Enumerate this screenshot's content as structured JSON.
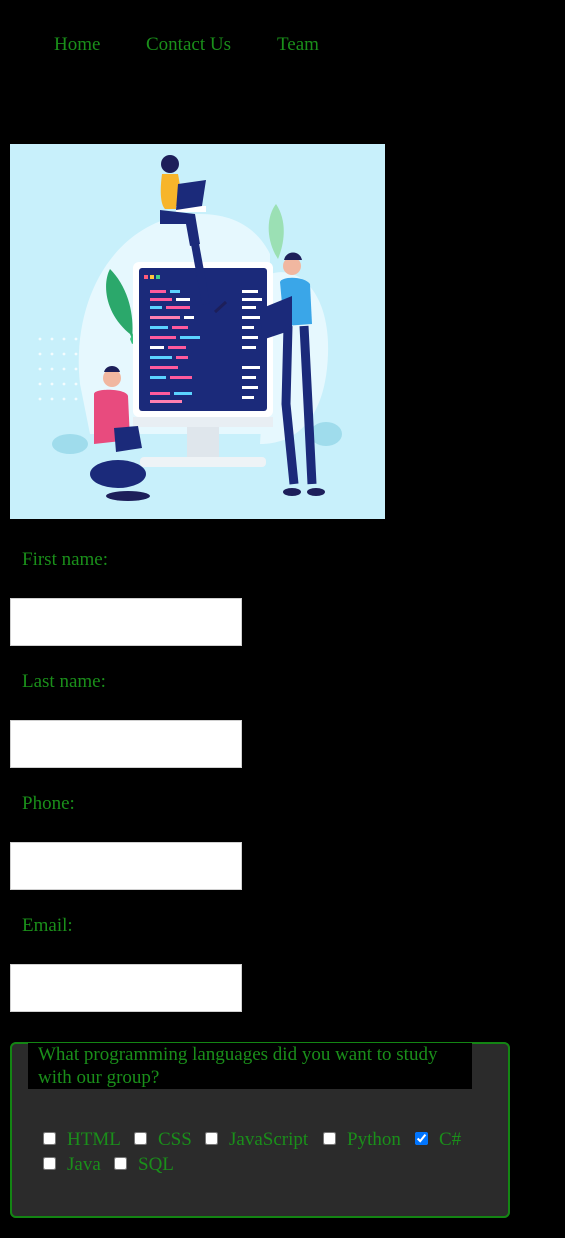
{
  "nav": {
    "items": [
      {
        "label": "Home"
      },
      {
        "label": "Contact Us"
      },
      {
        "label": "Team"
      }
    ]
  },
  "form": {
    "first_name_label": "First name:",
    "last_name_label": "Last name:",
    "phone_label": "Phone:",
    "email_label": "Email:",
    "first_name_value": "",
    "last_name_value": "",
    "phone_value": "",
    "email_value": ""
  },
  "languages": {
    "legend": "What programming languages did you want to study with our group?",
    "options": [
      {
        "label": "HTML",
        "checked": false
      },
      {
        "label": "CSS",
        "checked": false
      },
      {
        "label": "JavaScript",
        "checked": false
      },
      {
        "label": "Python",
        "checked": false
      },
      {
        "label": "C#",
        "checked": true
      },
      {
        "label": "Java",
        "checked": false
      },
      {
        "label": "SQL",
        "checked": false
      }
    ]
  },
  "colors": {
    "background": "#000000",
    "text_green": "#1a8f1a",
    "fieldset_bg": "#2b2b2b",
    "fieldset_border": "#138513",
    "checkbox_checked": "#1a73e8"
  }
}
